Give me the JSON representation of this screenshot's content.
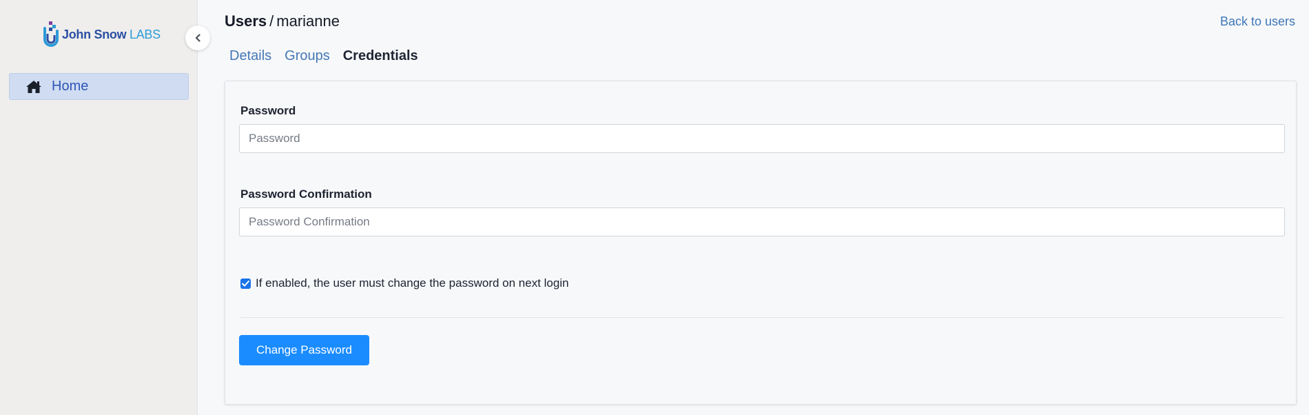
{
  "brand": {
    "name": "John Snow",
    "suffix": "LABS",
    "colors": {
      "primary": "#2b4fa3",
      "accent": "#2d9ad8"
    }
  },
  "sidebar": {
    "collapse_icon": "chevron-left-icon",
    "items": [
      {
        "label": "Home",
        "icon": "home-icon",
        "active": true
      }
    ]
  },
  "header": {
    "breadcrumb": {
      "root": "Users",
      "separator": "/",
      "current": "marianne"
    },
    "back_link": "Back to users"
  },
  "tabs": [
    {
      "label": "Details",
      "active": false
    },
    {
      "label": "Groups",
      "active": false
    },
    {
      "label": "Credentials",
      "active": true
    }
  ],
  "form": {
    "password": {
      "label": "Password",
      "placeholder": "Password",
      "value": ""
    },
    "password_confirmation": {
      "label": "Password Confirmation",
      "placeholder": "Password Confirmation",
      "value": ""
    },
    "force_change": {
      "checked": true,
      "label": "If enabled, the user must change the password on next login"
    },
    "submit_label": "Change Password"
  },
  "colors": {
    "primary_button": "#1a8cff",
    "link": "#4478b6",
    "nav_active_bg": "#cfdcf1"
  }
}
